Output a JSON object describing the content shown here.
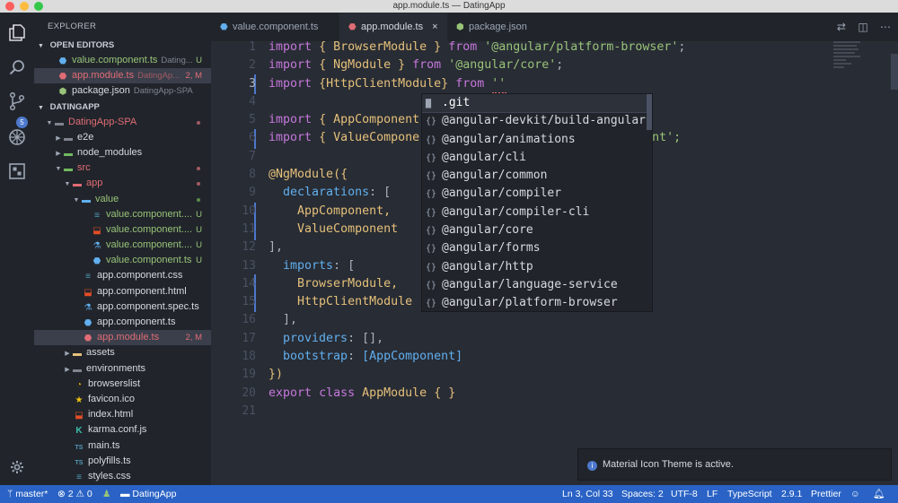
{
  "window": {
    "title": "app.module.ts — DatingApp"
  },
  "activity": {
    "scm_badge": "5"
  },
  "sidebar": {
    "title": "EXPLORER",
    "open_editors_label": "OPEN EDITORS",
    "open_editors": [
      {
        "name": "value.component.ts",
        "desc": "Dating...",
        "status": "U"
      },
      {
        "name": "app.module.ts",
        "desc": "DatingAp...",
        "status": "2, M"
      },
      {
        "name": "package.json",
        "desc": "DatingApp-SPA",
        "status": ""
      }
    ],
    "project_label": "DATINGAPP",
    "tree": {
      "root": "DatingApp-SPA",
      "e2e": "e2e",
      "node_modules": "node_modules",
      "src": "src",
      "app": "app",
      "value": "value",
      "value_files": [
        {
          "name": "value.component....",
          "status": "U"
        },
        {
          "name": "value.component....",
          "status": "U"
        },
        {
          "name": "value.component....",
          "status": "U"
        },
        {
          "name": "value.component.ts",
          "status": "U"
        }
      ],
      "app_files": [
        {
          "name": "app.component.css"
        },
        {
          "name": "app.component.html"
        },
        {
          "name": "app.component.spec.ts"
        },
        {
          "name": "app.component.ts"
        },
        {
          "name": "app.module.ts",
          "status": "2, M"
        }
      ],
      "assets": "assets",
      "environments": "environments",
      "src_files": [
        {
          "name": "browserslist"
        },
        {
          "name": "favicon.ico"
        },
        {
          "name": "index.html"
        },
        {
          "name": "karma.conf.js"
        },
        {
          "name": "main.ts"
        },
        {
          "name": "polyfills.ts"
        },
        {
          "name": "styles.css"
        }
      ]
    }
  },
  "tabs": [
    {
      "label": "value.component.ts"
    },
    {
      "label": "app.module.ts",
      "close": "×"
    },
    {
      "label": "package.json"
    }
  ],
  "editor": {
    "line_numbers": [
      "1",
      "2",
      "3",
      "4",
      "5",
      "6",
      "7",
      "8",
      "9",
      "10",
      "11",
      "12",
      "13",
      "14",
      "15",
      "16",
      "17",
      "18",
      "19",
      "20",
      "21"
    ],
    "tokens": {
      "import": "import",
      "from": "from",
      "export": "export",
      "class": "class",
      "lb": "{ ",
      "rb": " }",
      "lb_tight": "{",
      "rb_tight": "}",
      "semi": ";",
      "browser_module": "BrowserModule",
      "str_platform_browser": "'@angular/platform-browser'",
      "ng_module": "NgModule",
      "str_core": "'@angular/core'",
      "http_client_module": "HttpClientModule",
      "str_empty": "''",
      "app_component": "AppComponent",
      "value_component_trunc": "ValueCompone",
      "tail_line6": "nt';",
      "decorator": "@NgModule",
      "open_call": "({",
      "declarations": "declarations",
      "colon_bracket": ": [",
      "app_component_comma": "AppComponent,",
      "value_component": "ValueComponent",
      "close_bracket_comma": "],",
      "imports_key": "imports",
      "browser_module_comma": "BrowserModule,",
      "providers_line": "providers",
      "providers_val": ": [],",
      "bootstrap": "bootstrap",
      "bootstrap_val": "[AppComponent]",
      "close_call": "})",
      "app_module": "AppModule"
    }
  },
  "suggestions": [
    {
      "label": ".git",
      "icon": "folder"
    },
    {
      "label": "@angular-devkit/build-angular",
      "icon": "{}"
    },
    {
      "label": "@angular/animations",
      "icon": "{}"
    },
    {
      "label": "@angular/cli",
      "icon": "{}"
    },
    {
      "label": "@angular/common",
      "icon": "{}"
    },
    {
      "label": "@angular/compiler",
      "icon": "{}"
    },
    {
      "label": "@angular/compiler-cli",
      "icon": "{}"
    },
    {
      "label": "@angular/core",
      "icon": "{}"
    },
    {
      "label": "@angular/forms",
      "icon": "{}"
    },
    {
      "label": "@angular/http",
      "icon": "{}"
    },
    {
      "label": "@angular/language-service",
      "icon": "{}"
    },
    {
      "label": "@angular/platform-browser",
      "icon": "{}"
    }
  ],
  "notification": {
    "text": "Material Icon Theme is active."
  },
  "statusbar": {
    "branch": "master*",
    "errors": "2",
    "warnings": "0",
    "folder": "DatingApp",
    "position": "Ln 3, Col 33",
    "spaces": "Spaces: 2",
    "encoding": "UTF-8",
    "eol": "LF",
    "language": "TypeScript",
    "version": "2.9.1",
    "formatter": "Prettier"
  },
  "colors": {
    "statusbar_bg": "#2a63c5",
    "editor_bg": "#282c34",
    "sidebar_bg": "#21252b",
    "keyword": "#c678dd",
    "string": "#98c379",
    "type": "#e5c07b",
    "modified": "#e06c75"
  }
}
